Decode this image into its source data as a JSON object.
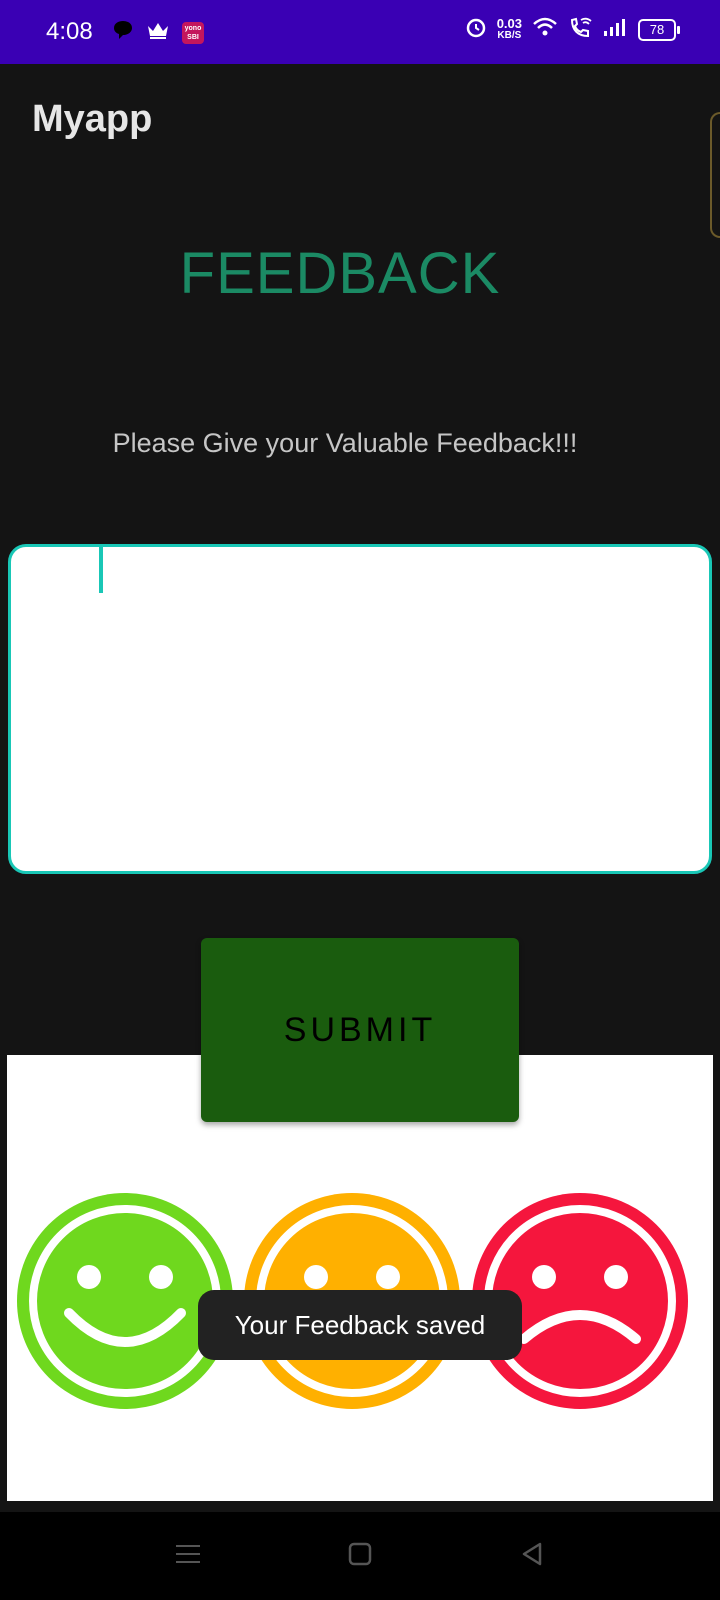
{
  "status_bar": {
    "time": "4:08",
    "left_icons": [
      "chat-bubble-icon",
      "crown-icon",
      "yono-sbi-app-icon"
    ],
    "yono_text": "yono SBI",
    "net_speed_value": "0.03",
    "net_speed_unit": "KB/S",
    "right_icons": [
      "alarm-icon",
      "wifi-icon",
      "wifi-calling-icon",
      "signal-icon",
      "battery-icon"
    ],
    "battery": "78",
    "background_color": "#3a00b4"
  },
  "app": {
    "title": "Myapp"
  },
  "main": {
    "heading": "FEEDBACK",
    "heading_color": "#1b8a64",
    "prompt": "Please Give your Valuable Feedback!!!",
    "feedback_input": {
      "value": "",
      "placeholder": "",
      "border_color": "#19c7b6"
    },
    "submit_label": "SUBMIT",
    "submit_color": "#1a5c0e"
  },
  "rating_image": {
    "faces": [
      {
        "mood": "happy",
        "color": "#6fd81e",
        "icon": "happy-face-icon"
      },
      {
        "mood": "neutral",
        "color": "#ffb000",
        "icon": "neutral-face-icon"
      },
      {
        "mood": "sad",
        "color": "#f5163d",
        "icon": "sad-face-icon"
      }
    ]
  },
  "toast": {
    "message": "Your Feedback saved"
  },
  "nav_bar": {
    "buttons": [
      "menu-icon",
      "home-icon",
      "back-icon"
    ]
  }
}
